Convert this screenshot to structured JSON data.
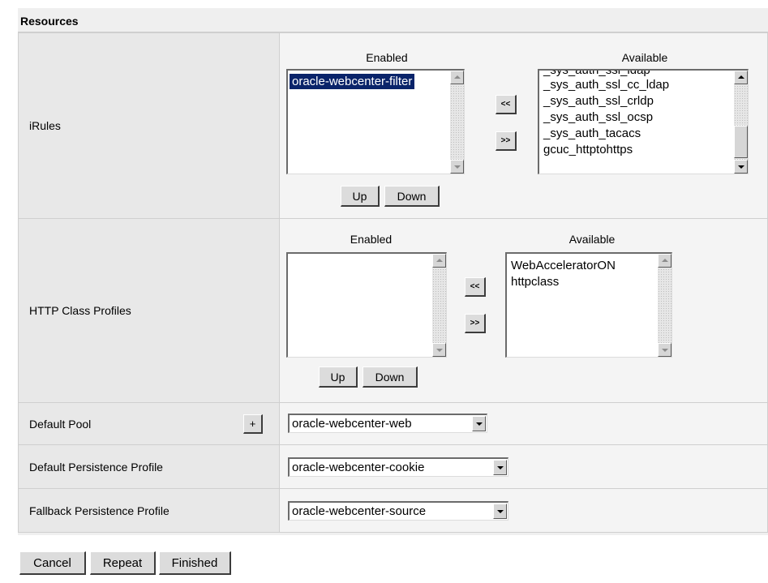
{
  "section_title": "Resources",
  "rows": {
    "irules": {
      "label": "iRules",
      "enabled_header": "Enabled",
      "available_header": "Available",
      "enabled_items": [
        "oracle-webcenter-filter"
      ],
      "available_items": [
        "_sys_auth_ssl_cc_ldap",
        "_sys_auth_ssl_crldp",
        "_sys_auth_ssl_ocsp",
        "_sys_auth_tacacs",
        "gcuc_httptohttps"
      ],
      "move_left_label": "<<",
      "move_right_label": ">>",
      "up_label": "Up",
      "down_label": "Down"
    },
    "http_class": {
      "label": "HTTP Class Profiles",
      "enabled_header": "Enabled",
      "available_header": "Available",
      "enabled_items": [],
      "available_items": [
        "WebAcceleratorON",
        "httpclass"
      ],
      "move_left_label": "<<",
      "move_right_label": ">>",
      "up_label": "Up",
      "down_label": "Down"
    },
    "default_pool": {
      "label": "Default Pool",
      "add_label": "+",
      "value": "oracle-webcenter-web"
    },
    "default_persistence": {
      "label": "Default Persistence Profile",
      "value": "oracle-webcenter-cookie"
    },
    "fallback_persistence": {
      "label": "Fallback Persistence Profile",
      "value": "oracle-webcenter-source"
    }
  },
  "footer": {
    "cancel_label": "Cancel",
    "repeat_label": "Repeat",
    "finished_label": "Finished"
  },
  "colors": {
    "selection": "#0a246a",
    "label_bg": "#e8e8e8",
    "value_bg": "#f4f4f4"
  }
}
